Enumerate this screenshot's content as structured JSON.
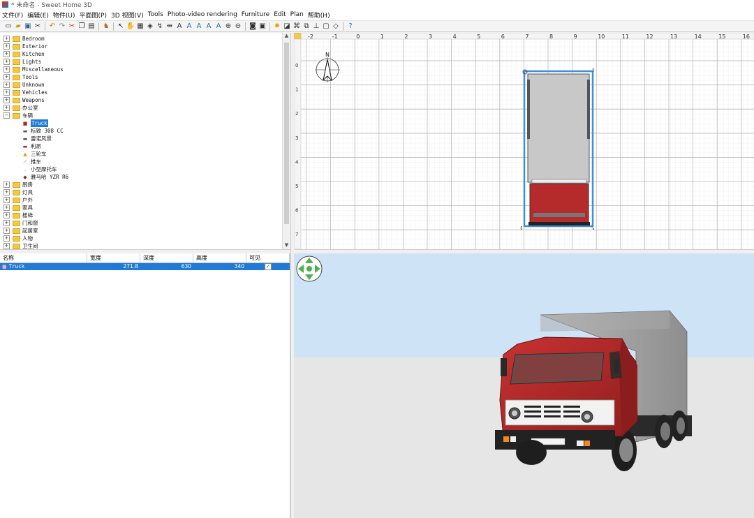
{
  "window": {
    "title": "* 未命名 - Sweet Home 3D"
  },
  "menu": [
    "文件(F)",
    "编辑(E)",
    "物件(U)",
    "平面图(P)",
    "3D 视图(V)",
    "Tools",
    "Photo-video rendering",
    "Furniture",
    "Edit",
    "Plan",
    "帮助(H)"
  ],
  "toolbar_icons": [
    "new-icon",
    "open-icon",
    "save-icon",
    "cut-icon",
    "undo-icon",
    "redo-icon",
    "cut2-icon",
    "copy-icon",
    "paste-icon",
    "add-furniture-icon",
    "select-icon",
    "pan-icon",
    "create-walls-icon",
    "create-rooms-icon",
    "create-polylines-icon",
    "create-dimensions-icon",
    "add-text-icon",
    "zoom-in-icon",
    "zoom-out-icon",
    "photo-icon",
    "video-icon",
    "help-icon"
  ],
  "catalog": {
    "folders_top": [
      "Bedroom",
      "Exterior",
      "Kitchen",
      "Lights",
      "Miscellaneous",
      "Tools",
      "Unknown",
      "Vehicles",
      "Weapons",
      "办公室"
    ],
    "open_folder": "车辆",
    "children": [
      "Truck",
      "标致 308 CC",
      "雷诺风景",
      "利昂",
      "三轮车",
      "推车",
      "小型摩托车",
      "雅马哈 YZR R6"
    ],
    "folders_bottom": [
      "厨房",
      "灯具",
      "户外",
      "家具",
      "楼梯",
      "门和窗",
      "起居室",
      "人物",
      "卫生间"
    ]
  },
  "furniture_table": {
    "headers": [
      "名称",
      "宽度",
      "深度",
      "高度",
      "可见"
    ],
    "rows": [
      {
        "name": "Truck",
        "width": "271.8",
        "depth": "630",
        "height": "340",
        "visible": true
      }
    ]
  },
  "plan": {
    "ruler_x": [
      "-2",
      "-1",
      "0",
      "1",
      "2",
      "3",
      "4",
      "5",
      "6",
      "7",
      "8",
      "9",
      "10",
      "11",
      "12",
      "13",
      "14",
      "15",
      "16"
    ],
    "ruler_y": [
      "0",
      "1",
      "2",
      "3",
      "4",
      "5",
      "6",
      "7"
    ],
    "compass_label": "N"
  },
  "colors": {
    "selection": "#1f7bd6",
    "sky": "#cfe3f7",
    "ground": "#e6e6e6",
    "truck_cab": "#b52a2a",
    "truck_box": "#b5b5b5"
  }
}
